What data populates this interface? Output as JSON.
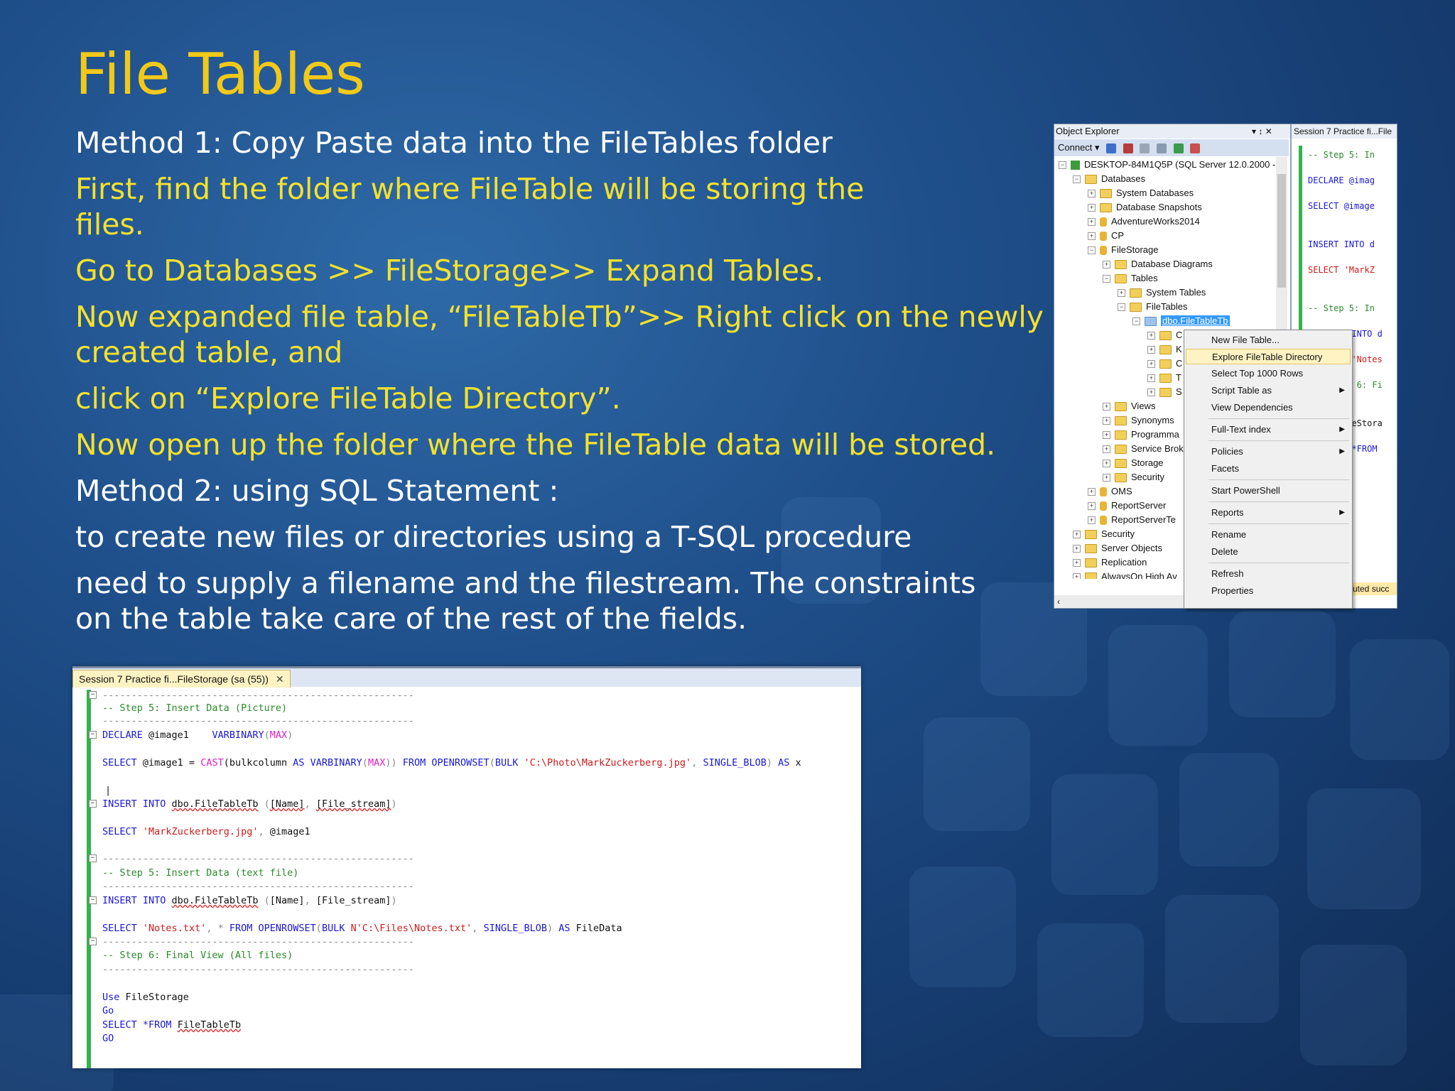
{
  "slide": {
    "title": "File Tables",
    "lines": [
      {
        "text": "Method 1: Copy Paste data into the FileTables folder",
        "color": "white"
      },
      {
        "text": "First, find the folder where FileTable will be storing the files.",
        "color": "yellow"
      },
      {
        "text": "Go to Databases >> FileStorage>> Expand Tables.",
        "color": "yellow"
      },
      {
        "text": "Now expanded file table, “FileTableTb”>> Right click on the newly created table, and",
        "color": "yellow"
      },
      {
        "text": "click on “Explore FileTable Directory”.",
        "color": "yellow"
      },
      {
        "text": "Now open up the folder where the FileTable data will be stored.",
        "color": "yellow"
      },
      {
        "text": "Method 2: using SQL Statement :",
        "color": "white"
      },
      {
        "text": "to create new files or directories using a T-SQL procedure",
        "color": "white"
      },
      {
        "text": "need to supply a filename and the filestream. The constraints on the table take care of the rest of the fields.",
        "color": "white"
      }
    ]
  },
  "colors": {
    "title": "#f2c919",
    "yellow": "#f5e12c",
    "white": "#ffffff",
    "accent_green": "#33b34a"
  },
  "code_window": {
    "tab_label": "Session 7 Practice fi...FileStorage (sa (55))",
    "close_glyph": "✕",
    "lines": {
      "dash": "------------------------------------------------------",
      "c1": "-- Step 5: Insert Data (Picture)",
      "declare_kw": "DECLARE",
      "declare_var": " @image1    ",
      "declare_type": "VARBINARY",
      "max": "MAX",
      "select": "SELECT",
      "sel1_var": " @image1 = ",
      "cast": "CAST",
      "sel1_b": "(bulkcolumn ",
      "as": "AS",
      "sel1_from": "FROM",
      "openrowset": "OPENROWSET",
      "bulk": "BULK",
      "path1": "'C:\\Photo\\MarkZuckerberg.jpg'",
      "single_blob": "SINGLE_BLOB",
      "alias_x": " x",
      "cursor": "|",
      "insert_into": "INSERT INTO",
      "table": "dbo.FileTableTb",
      "cols_name": "[Name]",
      "cols_stream": "[File_stream]",
      "str_mark": "'MarkZuckerberg.jpg'",
      "at_image": " @image1",
      "c2": "-- Step 5: Insert Data (text file)",
      "str_notes": "'Notes.txt'",
      "path2": "N'C:\\Files\\Notes.txt'",
      "filedata": " FileData",
      "c3": "-- Step 6: Final View (All files)",
      "use": "Use",
      "filestorage": " FileStorage",
      "go": "Go",
      "go2": "GO",
      "star_from": "*FROM",
      "filetabletb": "FileTableTb"
    }
  },
  "object_explorer": {
    "title": "Object Explorer",
    "title_icons": "▾ ↕ ✕",
    "connect": "Connect ▾",
    "tree": {
      "server": "DESKTOP-84M1Q5P (SQL Server 12.0.2000 -",
      "databases": "Databases",
      "system_databases": "System Databases",
      "snapshots": "Database Snapshots",
      "aw": "AdventureWorks2014",
      "cp": "CP",
      "filestorage": "FileStorage",
      "diagrams": "Database Diagrams",
      "tables": "Tables",
      "system_tables": "System Tables",
      "filetables": "FileTables",
      "selected": "dbo.FileTableTb",
      "c1": "C",
      "c2": "K",
      "c3": "C",
      "c4": "T",
      "c5": "S",
      "views": "Views",
      "synonyms": "Synonyms",
      "programma": "Programma",
      "service": "Service Brok",
      "storage": "Storage",
      "security_inner": "Security",
      "oms": "OMS",
      "reportserver": "ReportServer",
      "reportservertemp": "ReportServerTe",
      "security": "Security",
      "server_objects": "Server Objects",
      "replication": "Replication",
      "alwayson": "AlwaysOn High Av"
    },
    "hscroll_glyph": "‹"
  },
  "side_query": {
    "tab": "Session 7 Practice fi...File",
    "l1": "-- Step 5: In",
    "l2": "DECLARE @imag",
    "l3": "SELECT @image",
    "l4": "INSERT INTO d",
    "l5": "SELECT 'MarkZ",
    "l6": "-- Step 5: In",
    "l7": "T INTO d",
    "l8": "T 'Notes",
    "l9": "ep 6: Fi",
    "l10": "ileStora",
    "l11": "T *FROM",
    "status": "cuted succ"
  },
  "context_menu": {
    "items": {
      "new_file_table": "New File Table...",
      "explore": "Explore FileTable Directory",
      "select_top": "Select Top 1000 Rows",
      "script_table": "Script Table as",
      "view_deps": "View Dependencies",
      "fulltext": "Full-Text index",
      "policies": "Policies",
      "facets": "Facets",
      "powershell": "Start PowerShell",
      "reports": "Reports",
      "rename": "Rename",
      "delete": "Delete",
      "refresh": "Refresh",
      "properties": "Properties"
    },
    "submenu_arrow": "▶"
  }
}
